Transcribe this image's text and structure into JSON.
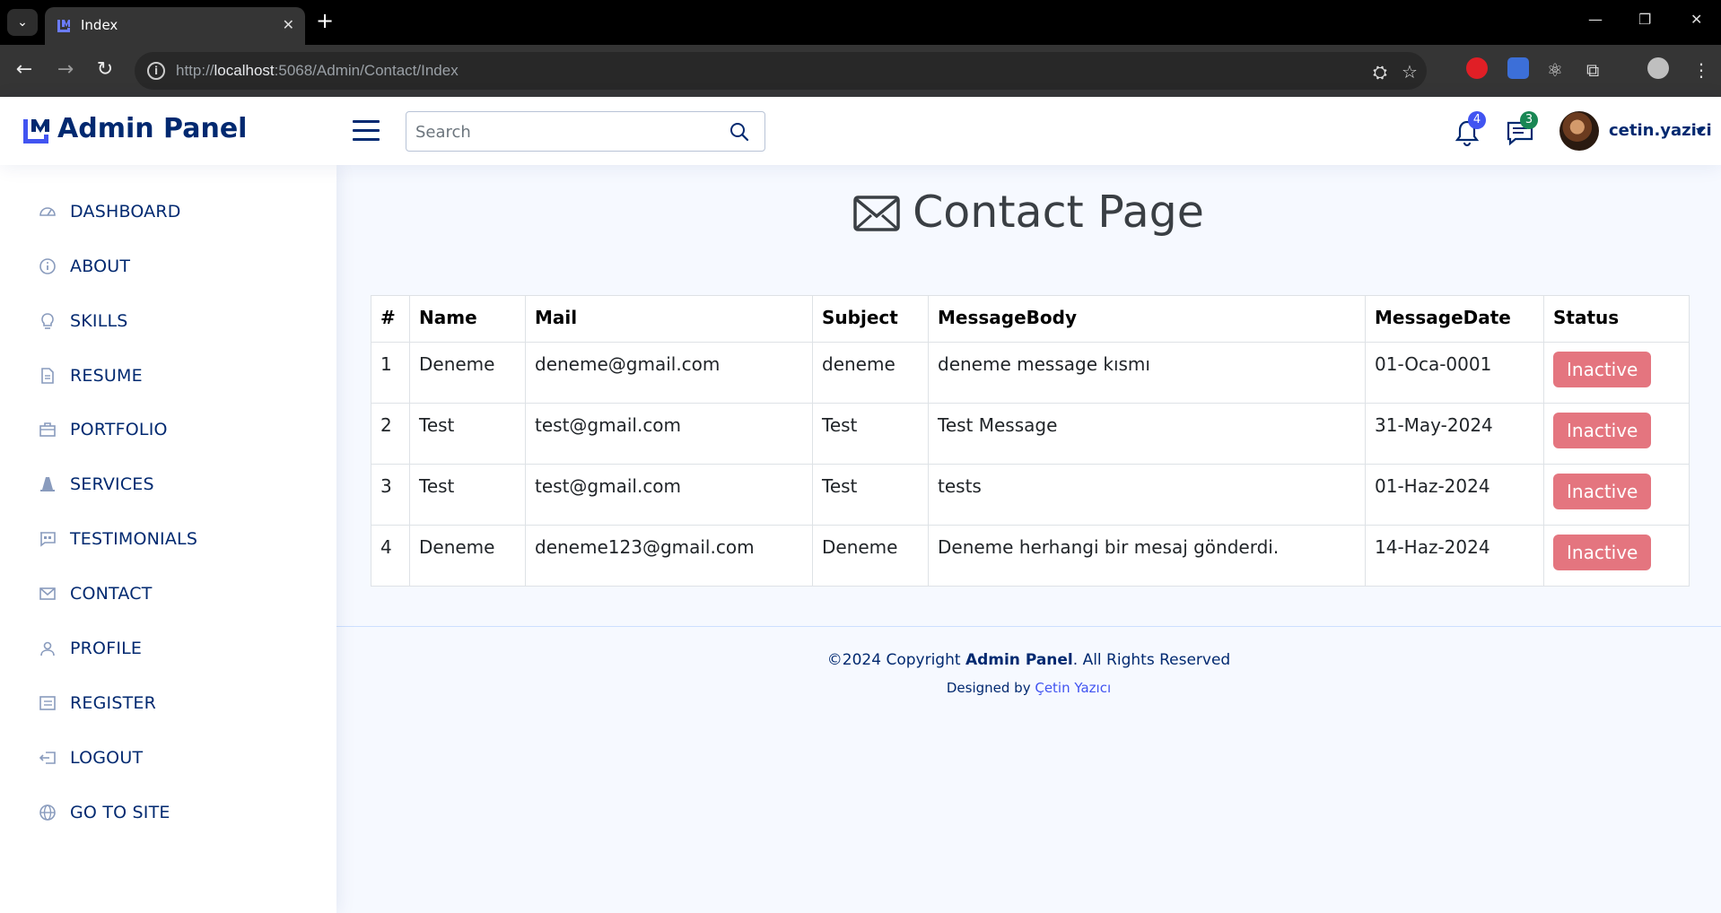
{
  "browser": {
    "tab_title": "Index",
    "url_host": "localhost",
    "url_rest": ":5068/Admin/Contact/Index",
    "url_scheme": "http://"
  },
  "header": {
    "brand": "Admin Panel",
    "search_placeholder": "Search",
    "notifications_count": "4",
    "messages_count": "3",
    "username": "cetin.yazici"
  },
  "sidebar": {
    "items": [
      {
        "label": "DASHBOARD",
        "icon": "speedometer-icon"
      },
      {
        "label": "ABOUT",
        "icon": "info-circle-icon"
      },
      {
        "label": "SKILLS",
        "icon": "lightbulb-icon"
      },
      {
        "label": "RESUME",
        "icon": "file-text-icon"
      },
      {
        "label": "PORTFOLIO",
        "icon": "briefcase-icon"
      },
      {
        "label": "SERVICES",
        "icon": "cone-icon"
      },
      {
        "label": "TESTIMONIALS",
        "icon": "chat-quote-icon"
      },
      {
        "label": "CONTACT",
        "icon": "envelope-icon"
      },
      {
        "label": "PROFILE",
        "icon": "person-icon"
      },
      {
        "label": "REGISTER",
        "icon": "card-list-icon"
      },
      {
        "label": "LOGOUT",
        "icon": "box-arrow-left-icon"
      },
      {
        "label": "GO TO SITE",
        "icon": "globe-icon"
      }
    ]
  },
  "main": {
    "title": "Contact Page",
    "table": {
      "headers": [
        "#",
        "Name",
        "Mail",
        "Subject",
        "MessageBody",
        "MessageDate",
        "Status"
      ],
      "rows": [
        {
          "id": "1",
          "name": "Deneme",
          "mail": "deneme@gmail.com",
          "subject": "deneme",
          "body": "deneme message kısmı",
          "date": "01-Oca-0001",
          "status": "Inactive"
        },
        {
          "id": "2",
          "name": "Test",
          "mail": "test@gmail.com",
          "subject": "Test",
          "body": "Test Message",
          "date": "31-May-2024",
          "status": "Inactive"
        },
        {
          "id": "3",
          "name": "Test",
          "mail": "test@gmail.com",
          "subject": "Test",
          "body": "tests",
          "date": "01-Haz-2024",
          "status": "Inactive"
        },
        {
          "id": "4",
          "name": "Deneme",
          "mail": "deneme123@gmail.com",
          "subject": "Deneme",
          "body": "Deneme herhangi bir mesaj gönderdi.",
          "date": "14-Haz-2024",
          "status": "Inactive"
        }
      ]
    }
  },
  "footer": {
    "copy_prefix": "©2024 Copyright ",
    "copy_brand": "Admin Panel",
    "copy_suffix": ". All Rights Reserved",
    "credit_prefix": "Designed by ",
    "credit_name": "Çetin Yazıcı"
  },
  "colors": {
    "brand": "#012970",
    "accent": "#4154f1",
    "inactive": "#e4757f",
    "page_bg": "#f6f9ff"
  }
}
